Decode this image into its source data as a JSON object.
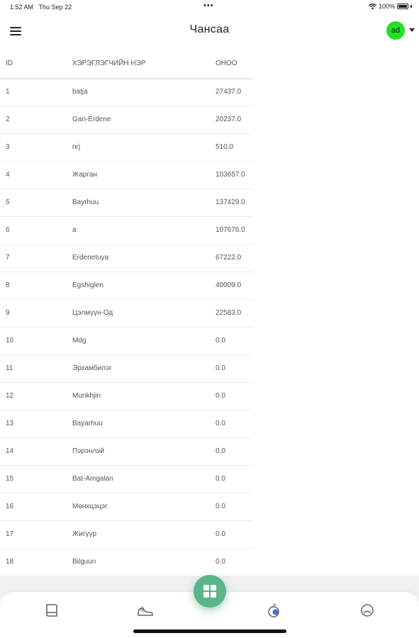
{
  "status_bar": {
    "time": "1:52 AM",
    "date": "Thu Sep 22",
    "battery": "100%"
  },
  "header": {
    "title": "Чансаа",
    "avatar_initials": "ad",
    "avatar_color": "#22e022"
  },
  "table": {
    "columns": [
      "ID",
      "ХЭРЭГЛЭГЧИЙН НЭР",
      "ОНОО"
    ],
    "rows": [
      [
        "1",
        "batja",
        "27437.0"
      ],
      [
        "2",
        "Gan-Erdene",
        "20237.0"
      ],
      [
        "3",
        "nrj",
        "510.0"
      ],
      [
        "4",
        "Жарган",
        "103657.0"
      ],
      [
        "5",
        "Bayrhuu",
        "137429.0"
      ],
      [
        "6",
        "a",
        "107676.0"
      ],
      [
        "7",
        "Erdenetuya",
        "67222.0"
      ],
      [
        "8",
        "Egshiglen",
        "40009.0"
      ],
      [
        "9",
        "Цэлмүүн-Од",
        "22583.0"
      ],
      [
        "10",
        "Mdg",
        "0.0"
      ],
      [
        "11",
        "Эрхамбилэг",
        "0.0"
      ],
      [
        "12",
        "Munkhjin",
        "0.0"
      ],
      [
        "13",
        "Bayarhuu",
        "0.0"
      ],
      [
        "14",
        "Пэрэнлэй",
        "0.0"
      ],
      [
        "15",
        "Bat-Amgalan",
        "0.0"
      ],
      [
        "16",
        "Мөнхцэцэг",
        "0.0"
      ],
      [
        "17",
        "Жигүүр",
        "0.0"
      ],
      [
        "18",
        "Bilguun",
        "0.0"
      ]
    ]
  },
  "tab_bar": {
    "icons": [
      "book-icon",
      "sneaker-icon",
      "dashboard-icon",
      "apple-icon",
      "profile-icon"
    ],
    "accent": "#5ab589"
  }
}
